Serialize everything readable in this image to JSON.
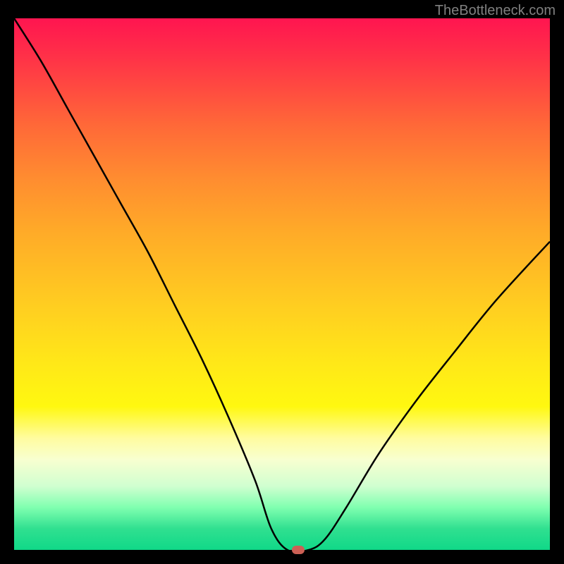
{
  "watermark": "TheBottleneck.com",
  "chart_data": {
    "type": "line",
    "title": "",
    "xlabel": "",
    "ylabel": "",
    "x_range": [
      0,
      100
    ],
    "y_range": [
      0,
      100
    ],
    "curve": {
      "x": [
        0,
        5,
        10,
        15,
        20,
        25,
        30,
        35,
        40,
        45,
        48,
        51,
        55,
        58,
        62,
        68,
        75,
        82,
        90,
        100
      ],
      "y": [
        100,
        92,
        83,
        74,
        65,
        56,
        46,
        36,
        25,
        13,
        4,
        0,
        0,
        2,
        8,
        18,
        28,
        37,
        47,
        58
      ]
    },
    "marker": {
      "x": 53,
      "y": 0
    },
    "gradient_stops": [
      {
        "pos": 0,
        "color": "#ff1550"
      },
      {
        "pos": 20,
        "color": "#ff6838"
      },
      {
        "pos": 40,
        "color": "#ffaa28"
      },
      {
        "pos": 65,
        "color": "#ffe818"
      },
      {
        "pos": 83,
        "color": "#f8ffd0"
      },
      {
        "pos": 100,
        "color": "#10d888"
      }
    ]
  }
}
